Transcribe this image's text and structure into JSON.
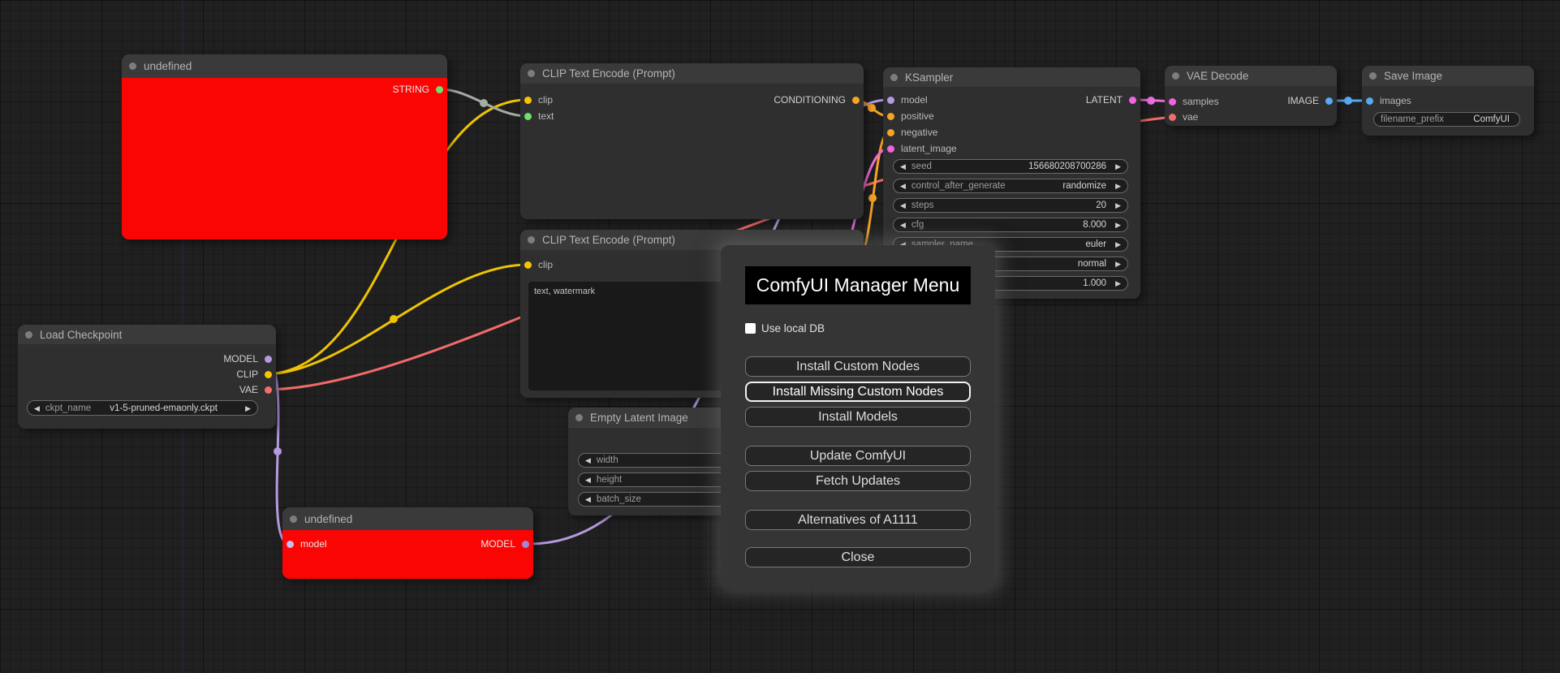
{
  "colors": {
    "slot_string_green": "#6fe06f",
    "slot_clip_yellow": "#f6c500",
    "slot_conditioning_orange": "#f7a325",
    "slot_model_lavender": "#b49ae0",
    "slot_model_in_light": "#cbbcf0",
    "slot_model_out_purple": "#9f88d8",
    "slot_latent_pink": "#f263e0",
    "slot_vae_salmon": "#f26d6d",
    "slot_image_blue": "#58a8f2",
    "link_string": "#a3aca3",
    "link_clip": "#eec300",
    "link_vae": "#f16a6a",
    "link_model": "#b49ae0",
    "link_conditioning": "#f7a325",
    "link_latent": "#ee6ddf",
    "link_image": "#58a8f2",
    "node_error_body": "#fb0404"
  },
  "nodes": [
    {
      "title": "undefined",
      "outputs": [
        {
          "name": "STRING",
          "color": "#6fe06f"
        }
      ]
    },
    {
      "title": "CLIP Text Encode (Prompt)",
      "inputs": [
        {
          "name": "clip",
          "color": "#f6c500"
        },
        {
          "name": "text",
          "color": "#6fe06f"
        }
      ],
      "outputs": [
        {
          "name": "CONDITIONING",
          "color": "#f7a325"
        }
      ]
    },
    {
      "title": "CLIP Text Encode (Prompt)",
      "inputs": [
        {
          "name": "clip",
          "color": "#f6c500"
        }
      ],
      "prompt_text": "text, watermark"
    },
    {
      "title": "KSampler",
      "inputs": [
        {
          "name": "model",
          "color": "#b49ae0"
        },
        {
          "name": "positive",
          "color": "#f7a325"
        },
        {
          "name": "negative",
          "color": "#f7a325"
        },
        {
          "name": "latent_image",
          "color": "#f263e0"
        }
      ],
      "outputs": [
        {
          "name": "LATENT",
          "color": "#f263e0"
        }
      ],
      "widgets": [
        {
          "label": "seed",
          "value": "156680208700286"
        },
        {
          "label": "control_after_generate",
          "value": "randomize"
        },
        {
          "label": "steps",
          "value": "20"
        },
        {
          "label": "cfg",
          "value": "8.000"
        },
        {
          "label": "sampler_name",
          "value": "euler"
        },
        {
          "label": "",
          "value": "normal"
        },
        {
          "label": "",
          "value": "1.000"
        }
      ]
    },
    {
      "title": "VAE Decode",
      "inputs": [
        {
          "name": "samples",
          "color": "#f263e0"
        },
        {
          "name": "vae",
          "color": "#f26d6d"
        }
      ],
      "outputs": [
        {
          "name": "IMAGE",
          "color": "#58a8f2"
        }
      ]
    },
    {
      "title": "Save Image",
      "inputs": [
        {
          "name": "images",
          "color": "#58a8f2"
        }
      ],
      "widgets": [
        {
          "label": "filename_prefix",
          "value": "ComfyUI"
        }
      ]
    },
    {
      "title": "Load Checkpoint",
      "outputs": [
        {
          "name": "MODEL",
          "color": "#b49ae0"
        },
        {
          "name": "CLIP",
          "color": "#f6c500"
        },
        {
          "name": "VAE",
          "color": "#f26d6d"
        }
      ],
      "widgets": [
        {
          "label": "ckpt_name",
          "value": "v1-5-pruned-emaonly.ckpt"
        }
      ]
    },
    {
      "title": "Empty Latent Image",
      "widgets": [
        {
          "label": "width",
          "value": ""
        },
        {
          "label": "height",
          "value": ""
        },
        {
          "label": "batch_size",
          "value": ""
        }
      ]
    },
    {
      "title": "undefined",
      "inputs": [
        {
          "name": "model",
          "color": "#cbbcf0"
        }
      ],
      "outputs": [
        {
          "name": "MODEL",
          "color": "#9f88d8"
        }
      ]
    }
  ],
  "dialog": {
    "title": "ComfyUI Manager Menu",
    "checkbox_label": "Use local DB",
    "checkbox_checked": false,
    "buttons": [
      "Install Custom Nodes",
      "Install Missing Custom Nodes",
      "Install Models",
      "Update ComfyUI",
      "Fetch Updates",
      "Alternatives of A1111",
      "Close"
    ],
    "highlighted_button": "Install Missing Custom Nodes"
  }
}
